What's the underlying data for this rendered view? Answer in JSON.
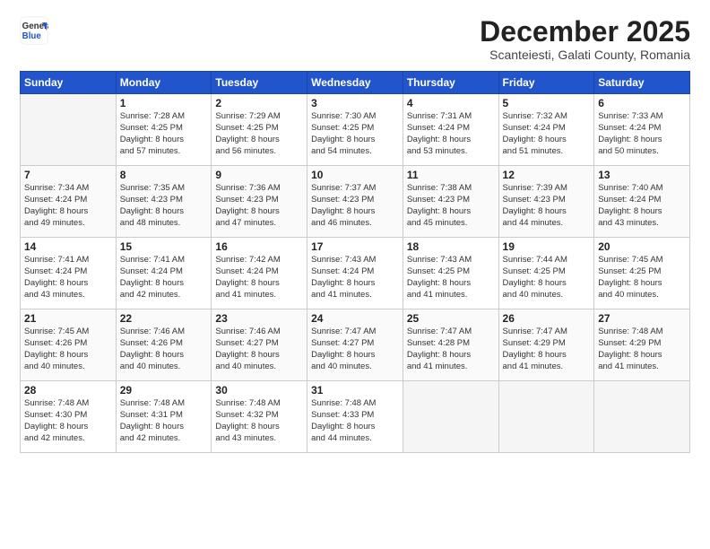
{
  "header": {
    "logo_general": "General",
    "logo_blue": "Blue",
    "month": "December 2025",
    "location": "Scanteiesti, Galati County, Romania"
  },
  "days_of_week": [
    "Sunday",
    "Monday",
    "Tuesday",
    "Wednesday",
    "Thursday",
    "Friday",
    "Saturday"
  ],
  "weeks": [
    [
      {
        "day": "",
        "info": ""
      },
      {
        "day": "1",
        "info": "Sunrise: 7:28 AM\nSunset: 4:25 PM\nDaylight: 8 hours\nand 57 minutes."
      },
      {
        "day": "2",
        "info": "Sunrise: 7:29 AM\nSunset: 4:25 PM\nDaylight: 8 hours\nand 56 minutes."
      },
      {
        "day": "3",
        "info": "Sunrise: 7:30 AM\nSunset: 4:25 PM\nDaylight: 8 hours\nand 54 minutes."
      },
      {
        "day": "4",
        "info": "Sunrise: 7:31 AM\nSunset: 4:24 PM\nDaylight: 8 hours\nand 53 minutes."
      },
      {
        "day": "5",
        "info": "Sunrise: 7:32 AM\nSunset: 4:24 PM\nDaylight: 8 hours\nand 51 minutes."
      },
      {
        "day": "6",
        "info": "Sunrise: 7:33 AM\nSunset: 4:24 PM\nDaylight: 8 hours\nand 50 minutes."
      }
    ],
    [
      {
        "day": "7",
        "info": "Sunrise: 7:34 AM\nSunset: 4:24 PM\nDaylight: 8 hours\nand 49 minutes."
      },
      {
        "day": "8",
        "info": "Sunrise: 7:35 AM\nSunset: 4:23 PM\nDaylight: 8 hours\nand 48 minutes."
      },
      {
        "day": "9",
        "info": "Sunrise: 7:36 AM\nSunset: 4:23 PM\nDaylight: 8 hours\nand 47 minutes."
      },
      {
        "day": "10",
        "info": "Sunrise: 7:37 AM\nSunset: 4:23 PM\nDaylight: 8 hours\nand 46 minutes."
      },
      {
        "day": "11",
        "info": "Sunrise: 7:38 AM\nSunset: 4:23 PM\nDaylight: 8 hours\nand 45 minutes."
      },
      {
        "day": "12",
        "info": "Sunrise: 7:39 AM\nSunset: 4:23 PM\nDaylight: 8 hours\nand 44 minutes."
      },
      {
        "day": "13",
        "info": "Sunrise: 7:40 AM\nSunset: 4:24 PM\nDaylight: 8 hours\nand 43 minutes."
      }
    ],
    [
      {
        "day": "14",
        "info": "Sunrise: 7:41 AM\nSunset: 4:24 PM\nDaylight: 8 hours\nand 43 minutes."
      },
      {
        "day": "15",
        "info": "Sunrise: 7:41 AM\nSunset: 4:24 PM\nDaylight: 8 hours\nand 42 minutes."
      },
      {
        "day": "16",
        "info": "Sunrise: 7:42 AM\nSunset: 4:24 PM\nDaylight: 8 hours\nand 41 minutes."
      },
      {
        "day": "17",
        "info": "Sunrise: 7:43 AM\nSunset: 4:24 PM\nDaylight: 8 hours\nand 41 minutes."
      },
      {
        "day": "18",
        "info": "Sunrise: 7:43 AM\nSunset: 4:25 PM\nDaylight: 8 hours\nand 41 minutes."
      },
      {
        "day": "19",
        "info": "Sunrise: 7:44 AM\nSunset: 4:25 PM\nDaylight: 8 hours\nand 40 minutes."
      },
      {
        "day": "20",
        "info": "Sunrise: 7:45 AM\nSunset: 4:25 PM\nDaylight: 8 hours\nand 40 minutes."
      }
    ],
    [
      {
        "day": "21",
        "info": "Sunrise: 7:45 AM\nSunset: 4:26 PM\nDaylight: 8 hours\nand 40 minutes."
      },
      {
        "day": "22",
        "info": "Sunrise: 7:46 AM\nSunset: 4:26 PM\nDaylight: 8 hours\nand 40 minutes."
      },
      {
        "day": "23",
        "info": "Sunrise: 7:46 AM\nSunset: 4:27 PM\nDaylight: 8 hours\nand 40 minutes."
      },
      {
        "day": "24",
        "info": "Sunrise: 7:47 AM\nSunset: 4:27 PM\nDaylight: 8 hours\nand 40 minutes."
      },
      {
        "day": "25",
        "info": "Sunrise: 7:47 AM\nSunset: 4:28 PM\nDaylight: 8 hours\nand 41 minutes."
      },
      {
        "day": "26",
        "info": "Sunrise: 7:47 AM\nSunset: 4:29 PM\nDaylight: 8 hours\nand 41 minutes."
      },
      {
        "day": "27",
        "info": "Sunrise: 7:48 AM\nSunset: 4:29 PM\nDaylight: 8 hours\nand 41 minutes."
      }
    ],
    [
      {
        "day": "28",
        "info": "Sunrise: 7:48 AM\nSunset: 4:30 PM\nDaylight: 8 hours\nand 42 minutes."
      },
      {
        "day": "29",
        "info": "Sunrise: 7:48 AM\nSunset: 4:31 PM\nDaylight: 8 hours\nand 42 minutes."
      },
      {
        "day": "30",
        "info": "Sunrise: 7:48 AM\nSunset: 4:32 PM\nDaylight: 8 hours\nand 43 minutes."
      },
      {
        "day": "31",
        "info": "Sunrise: 7:48 AM\nSunset: 4:33 PM\nDaylight: 8 hours\nand 44 minutes."
      },
      {
        "day": "",
        "info": ""
      },
      {
        "day": "",
        "info": ""
      },
      {
        "day": "",
        "info": ""
      }
    ]
  ]
}
